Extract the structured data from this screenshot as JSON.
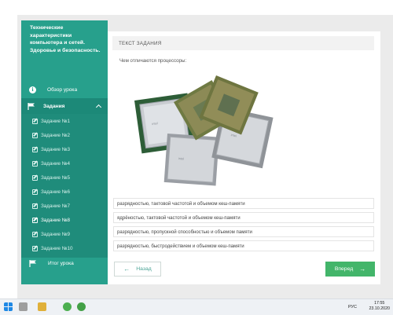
{
  "sidebar": {
    "course_title": "Технические характеристики компьютера и сетей. Здоровье и безопасность.",
    "overview_label": "Обзор урока",
    "tasks_label": "Задания",
    "tasks": [
      {
        "label": "Задание №1",
        "active": false
      },
      {
        "label": "Задание №2",
        "active": false
      },
      {
        "label": "Задание №3",
        "active": false
      },
      {
        "label": "Задание №4",
        "active": false
      },
      {
        "label": "Задание №5",
        "active": false
      },
      {
        "label": "Задание №6",
        "active": false
      },
      {
        "label": "Задание №7",
        "active": false
      },
      {
        "label": "Задание №8",
        "active": true
      },
      {
        "label": "Задание №9",
        "active": false
      },
      {
        "label": "Задание №10",
        "active": false
      }
    ],
    "summary_label": "Итог урока"
  },
  "task": {
    "header": "ТЕКСТ ЗАДАНИЯ",
    "question": "Чем отличаются процессоры:",
    "answers": [
      "разрядностью, тактовой частотой и объемом кеш-памяти",
      "ядрёностью, тактовой частотой и объемом кеш-памяти",
      "разрядностью, пропускной способностью и объемом памяти",
      "разрядностью, быстродействием и объемом кеш-памяти"
    ],
    "back_label": "Назад",
    "next_label": "Вперед"
  },
  "taskbar": {
    "language": "РУС",
    "time": "17:55",
    "date": "23.10.2020"
  },
  "colors": {
    "sidebar": "#27a08c",
    "sidebar_dark": "#1f8c7b",
    "next_button": "#43b56a"
  }
}
